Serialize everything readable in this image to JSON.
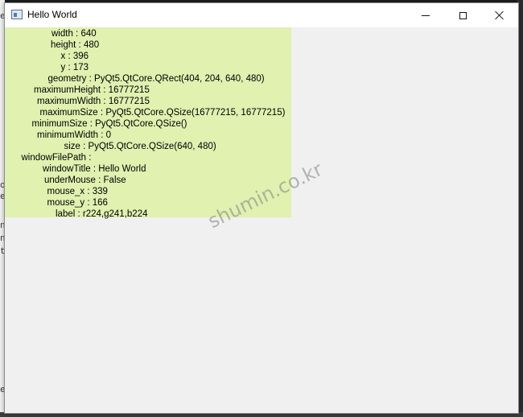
{
  "window": {
    "title": "Hello World"
  },
  "label": {
    "background": "#e0f1b0",
    "lines": [
      {
        "key": "width",
        "value": "640"
      },
      {
        "key": "height",
        "value": "480"
      },
      {
        "key": "x",
        "value": "396"
      },
      {
        "key": "y",
        "value": "173"
      },
      {
        "key": "geometry",
        "value": "PyQt5.QtCore.QRect(404, 204, 640, 480)"
      },
      {
        "key": "maximumHeight",
        "value": "16777215"
      },
      {
        "key": "maximumWidth",
        "value": "16777215"
      },
      {
        "key": "maximumSize",
        "value": "PyQt5.QtCore.QSize(16777215, 16777215)"
      },
      {
        "key": "minimumSize",
        "value": "PyQt5.QtCore.QSize()"
      },
      {
        "key": "minimumWidth",
        "value": "0"
      },
      {
        "key": "size",
        "value": "PyQt5.QtCore.QSize(640, 480)"
      },
      {
        "key": "windowFilePath",
        "value": ""
      },
      {
        "key": "windowTitle",
        "value": "Hello World"
      },
      {
        "key": "underMouse",
        "value": "False"
      },
      {
        "key": "mouse_x",
        "value": "339"
      },
      {
        "key": "mouse_y",
        "value": "166"
      },
      {
        "key": "label",
        "value": "r224,g241,b224"
      }
    ]
  },
  "watermark": "shumin.co.kr",
  "backdrop_chars": [
    "e",
    "o",
    "e",
    "n",
    "n",
    "t",
    "e"
  ]
}
